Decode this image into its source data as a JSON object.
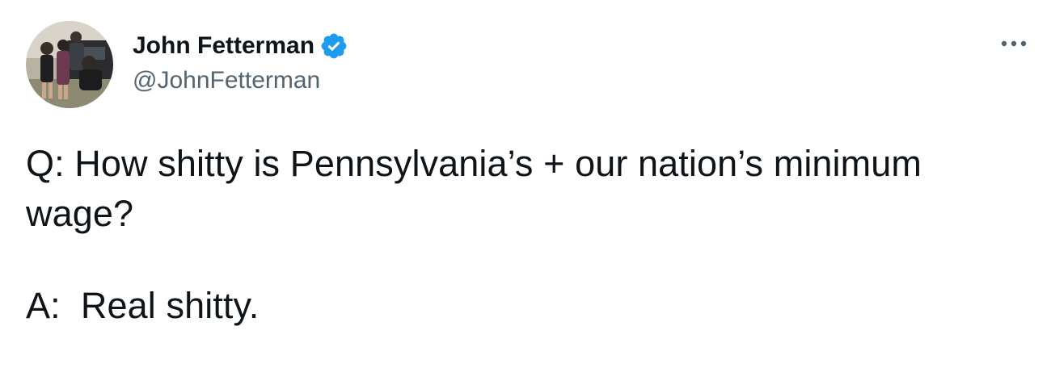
{
  "tweet": {
    "author": {
      "display_name": "John Fetterman",
      "handle": "@JohnFetterman",
      "verified": true,
      "avatar_icon": "profile-photo"
    },
    "more_icon": "more-options-icon",
    "text": {
      "question": "Q: How shitty is Pennsylvania’s + our nation’s minimum wage?",
      "answer": "A:  Real shitty."
    },
    "colors": {
      "verified_blue": "#1d9bf0",
      "handle_gray": "#536471",
      "text": "#0f1419"
    }
  }
}
